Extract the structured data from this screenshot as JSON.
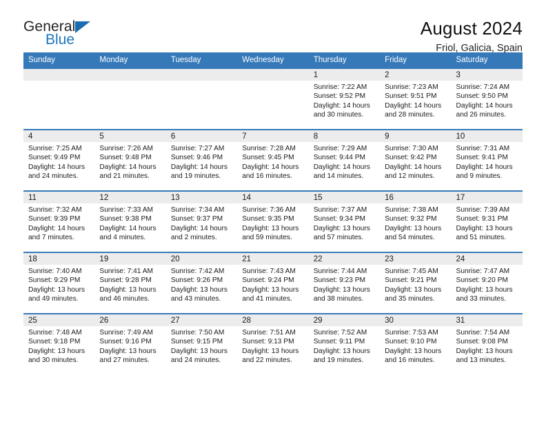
{
  "brand": {
    "name_part1": "General",
    "name_part2": "Blue",
    "triangle_color": "#1b6cb0"
  },
  "header": {
    "title": "August 2024",
    "subtitle": "Friol, Galicia, Spain"
  },
  "theme": {
    "header_row_color": "#3679b9",
    "daynum_bar_color": "#ececec",
    "text_color": "#1a1a1a"
  },
  "weekday_headers": [
    "Sunday",
    "Monday",
    "Tuesday",
    "Wednesday",
    "Thursday",
    "Friday",
    "Saturday"
  ],
  "weeks": [
    [
      {
        "day": "",
        "sunrise": "",
        "sunset": "",
        "daylight": "",
        "empty": true
      },
      {
        "day": "",
        "sunrise": "",
        "sunset": "",
        "daylight": "",
        "empty": true
      },
      {
        "day": "",
        "sunrise": "",
        "sunset": "",
        "daylight": "",
        "empty": true
      },
      {
        "day": "",
        "sunrise": "",
        "sunset": "",
        "daylight": "",
        "empty": true
      },
      {
        "day": "1",
        "sunrise": "Sunrise: 7:22 AM",
        "sunset": "Sunset: 9:52 PM",
        "daylight": "Daylight: 14 hours and 30 minutes."
      },
      {
        "day": "2",
        "sunrise": "Sunrise: 7:23 AM",
        "sunset": "Sunset: 9:51 PM",
        "daylight": "Daylight: 14 hours and 28 minutes."
      },
      {
        "day": "3",
        "sunrise": "Sunrise: 7:24 AM",
        "sunset": "Sunset: 9:50 PM",
        "daylight": "Daylight: 14 hours and 26 minutes."
      }
    ],
    [
      {
        "day": "4",
        "sunrise": "Sunrise: 7:25 AM",
        "sunset": "Sunset: 9:49 PM",
        "daylight": "Daylight: 14 hours and 24 minutes."
      },
      {
        "day": "5",
        "sunrise": "Sunrise: 7:26 AM",
        "sunset": "Sunset: 9:48 PM",
        "daylight": "Daylight: 14 hours and 21 minutes."
      },
      {
        "day": "6",
        "sunrise": "Sunrise: 7:27 AM",
        "sunset": "Sunset: 9:46 PM",
        "daylight": "Daylight: 14 hours and 19 minutes."
      },
      {
        "day": "7",
        "sunrise": "Sunrise: 7:28 AM",
        "sunset": "Sunset: 9:45 PM",
        "daylight": "Daylight: 14 hours and 16 minutes."
      },
      {
        "day": "8",
        "sunrise": "Sunrise: 7:29 AM",
        "sunset": "Sunset: 9:44 PM",
        "daylight": "Daylight: 14 hours and 14 minutes."
      },
      {
        "day": "9",
        "sunrise": "Sunrise: 7:30 AM",
        "sunset": "Sunset: 9:42 PM",
        "daylight": "Daylight: 14 hours and 12 minutes."
      },
      {
        "day": "10",
        "sunrise": "Sunrise: 7:31 AM",
        "sunset": "Sunset: 9:41 PM",
        "daylight": "Daylight: 14 hours and 9 minutes."
      }
    ],
    [
      {
        "day": "11",
        "sunrise": "Sunrise: 7:32 AM",
        "sunset": "Sunset: 9:39 PM",
        "daylight": "Daylight: 14 hours and 7 minutes."
      },
      {
        "day": "12",
        "sunrise": "Sunrise: 7:33 AM",
        "sunset": "Sunset: 9:38 PM",
        "daylight": "Daylight: 14 hours and 4 minutes."
      },
      {
        "day": "13",
        "sunrise": "Sunrise: 7:34 AM",
        "sunset": "Sunset: 9:37 PM",
        "daylight": "Daylight: 14 hours and 2 minutes."
      },
      {
        "day": "14",
        "sunrise": "Sunrise: 7:36 AM",
        "sunset": "Sunset: 9:35 PM",
        "daylight": "Daylight: 13 hours and 59 minutes."
      },
      {
        "day": "15",
        "sunrise": "Sunrise: 7:37 AM",
        "sunset": "Sunset: 9:34 PM",
        "daylight": "Daylight: 13 hours and 57 minutes."
      },
      {
        "day": "16",
        "sunrise": "Sunrise: 7:38 AM",
        "sunset": "Sunset: 9:32 PM",
        "daylight": "Daylight: 13 hours and 54 minutes."
      },
      {
        "day": "17",
        "sunrise": "Sunrise: 7:39 AM",
        "sunset": "Sunset: 9:31 PM",
        "daylight": "Daylight: 13 hours and 51 minutes."
      }
    ],
    [
      {
        "day": "18",
        "sunrise": "Sunrise: 7:40 AM",
        "sunset": "Sunset: 9:29 PM",
        "daylight": "Daylight: 13 hours and 49 minutes."
      },
      {
        "day": "19",
        "sunrise": "Sunrise: 7:41 AM",
        "sunset": "Sunset: 9:28 PM",
        "daylight": "Daylight: 13 hours and 46 minutes."
      },
      {
        "day": "20",
        "sunrise": "Sunrise: 7:42 AM",
        "sunset": "Sunset: 9:26 PM",
        "daylight": "Daylight: 13 hours and 43 minutes."
      },
      {
        "day": "21",
        "sunrise": "Sunrise: 7:43 AM",
        "sunset": "Sunset: 9:24 PM",
        "daylight": "Daylight: 13 hours and 41 minutes."
      },
      {
        "day": "22",
        "sunrise": "Sunrise: 7:44 AM",
        "sunset": "Sunset: 9:23 PM",
        "daylight": "Daylight: 13 hours and 38 minutes."
      },
      {
        "day": "23",
        "sunrise": "Sunrise: 7:45 AM",
        "sunset": "Sunset: 9:21 PM",
        "daylight": "Daylight: 13 hours and 35 minutes."
      },
      {
        "day": "24",
        "sunrise": "Sunrise: 7:47 AM",
        "sunset": "Sunset: 9:20 PM",
        "daylight": "Daylight: 13 hours and 33 minutes."
      }
    ],
    [
      {
        "day": "25",
        "sunrise": "Sunrise: 7:48 AM",
        "sunset": "Sunset: 9:18 PM",
        "daylight": "Daylight: 13 hours and 30 minutes."
      },
      {
        "day": "26",
        "sunrise": "Sunrise: 7:49 AM",
        "sunset": "Sunset: 9:16 PM",
        "daylight": "Daylight: 13 hours and 27 minutes."
      },
      {
        "day": "27",
        "sunrise": "Sunrise: 7:50 AM",
        "sunset": "Sunset: 9:15 PM",
        "daylight": "Daylight: 13 hours and 24 minutes."
      },
      {
        "day": "28",
        "sunrise": "Sunrise: 7:51 AM",
        "sunset": "Sunset: 9:13 PM",
        "daylight": "Daylight: 13 hours and 22 minutes."
      },
      {
        "day": "29",
        "sunrise": "Sunrise: 7:52 AM",
        "sunset": "Sunset: 9:11 PM",
        "daylight": "Daylight: 13 hours and 19 minutes."
      },
      {
        "day": "30",
        "sunrise": "Sunrise: 7:53 AM",
        "sunset": "Sunset: 9:10 PM",
        "daylight": "Daylight: 13 hours and 16 minutes."
      },
      {
        "day": "31",
        "sunrise": "Sunrise: 7:54 AM",
        "sunset": "Sunset: 9:08 PM",
        "daylight": "Daylight: 13 hours and 13 minutes."
      }
    ]
  ]
}
